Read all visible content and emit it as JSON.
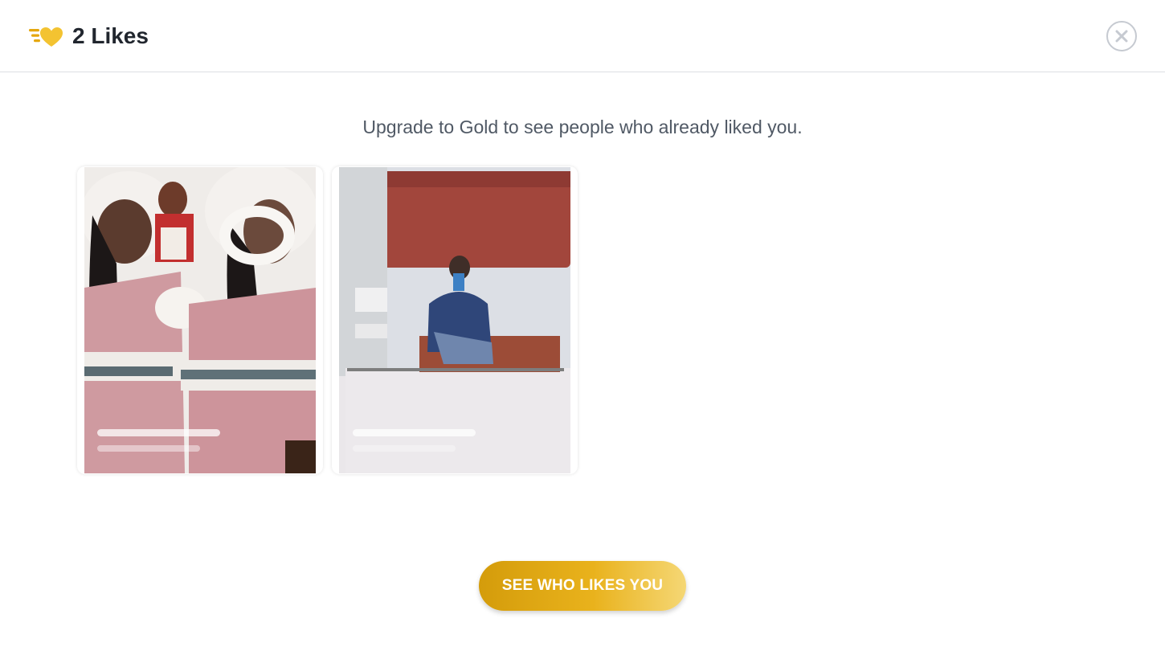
{
  "header": {
    "title": "2 Likes",
    "icon": "likes-heart-icon",
    "close_icon": "close-icon",
    "accent": "#f0b429"
  },
  "main": {
    "subtitle": "Upgrade to Gold to see people who already liked you.",
    "cards": [
      {
        "photo": "blurred-profile-photo-dolls",
        "name_placeholder": "",
        "detail_placeholder": ""
      },
      {
        "photo": "blurred-profile-photo-mirror-selfie",
        "name_placeholder": "",
        "detail_placeholder": ""
      }
    ]
  },
  "cta": {
    "label": "SEE WHO LIKES YOU",
    "gradient": [
      "#d49c0b",
      "#e9b21c",
      "#f5d775"
    ]
  }
}
